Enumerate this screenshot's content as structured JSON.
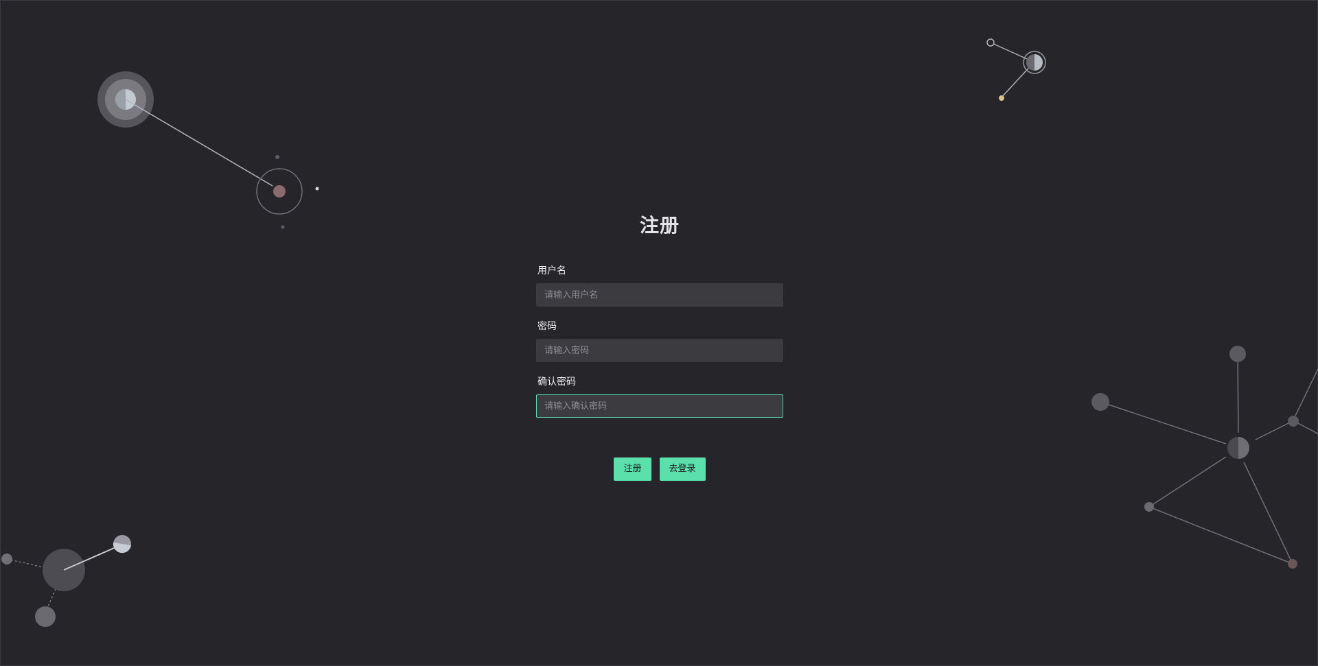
{
  "form": {
    "title": "注册",
    "username": {
      "label": "用户名",
      "placeholder": "请输入用户名",
      "value": ""
    },
    "password": {
      "label": "密码",
      "placeholder": "请输入密码",
      "value": ""
    },
    "confirm_password": {
      "label": "确认密码",
      "placeholder": "请输入确认密码",
      "value": ""
    }
  },
  "buttons": {
    "register_label": "注册",
    "to_login_label": "去登录"
  },
  "colors": {
    "background": "#25252a",
    "input_background": "#3b3b40",
    "accent": "#5be0ac",
    "focus_border": "#5fd4a6",
    "text": "#f0f0f2"
  },
  "icons": [
    "molecule-network-decoration"
  ]
}
